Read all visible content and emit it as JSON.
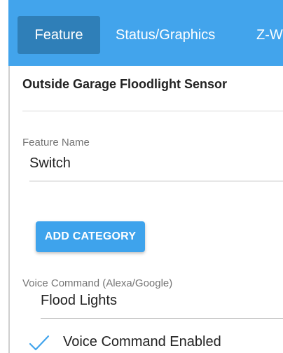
{
  "tabs": [
    {
      "label": "Feature",
      "active": true
    },
    {
      "label": "Status/Graphics",
      "active": false
    },
    {
      "label": "Z-W",
      "active": false
    }
  ],
  "device": {
    "title": "Outside Garage Floodlight Sensor"
  },
  "feature_name": {
    "label": "Feature Name",
    "value": "Switch"
  },
  "add_category": {
    "label": "ADD CATEGORY"
  },
  "voice_command": {
    "label": "Voice Command (Alexa/Google)",
    "value": "Flood Lights",
    "enabled_label": "Voice Command Enabled",
    "enabled": true
  },
  "colors": {
    "tabbar": "#42a4ec",
    "tab_active": "#2f7fb8",
    "button": "#3ea3ec",
    "check": "#42a4ec"
  },
  "icons": {
    "voice_enabled": "check-icon"
  }
}
